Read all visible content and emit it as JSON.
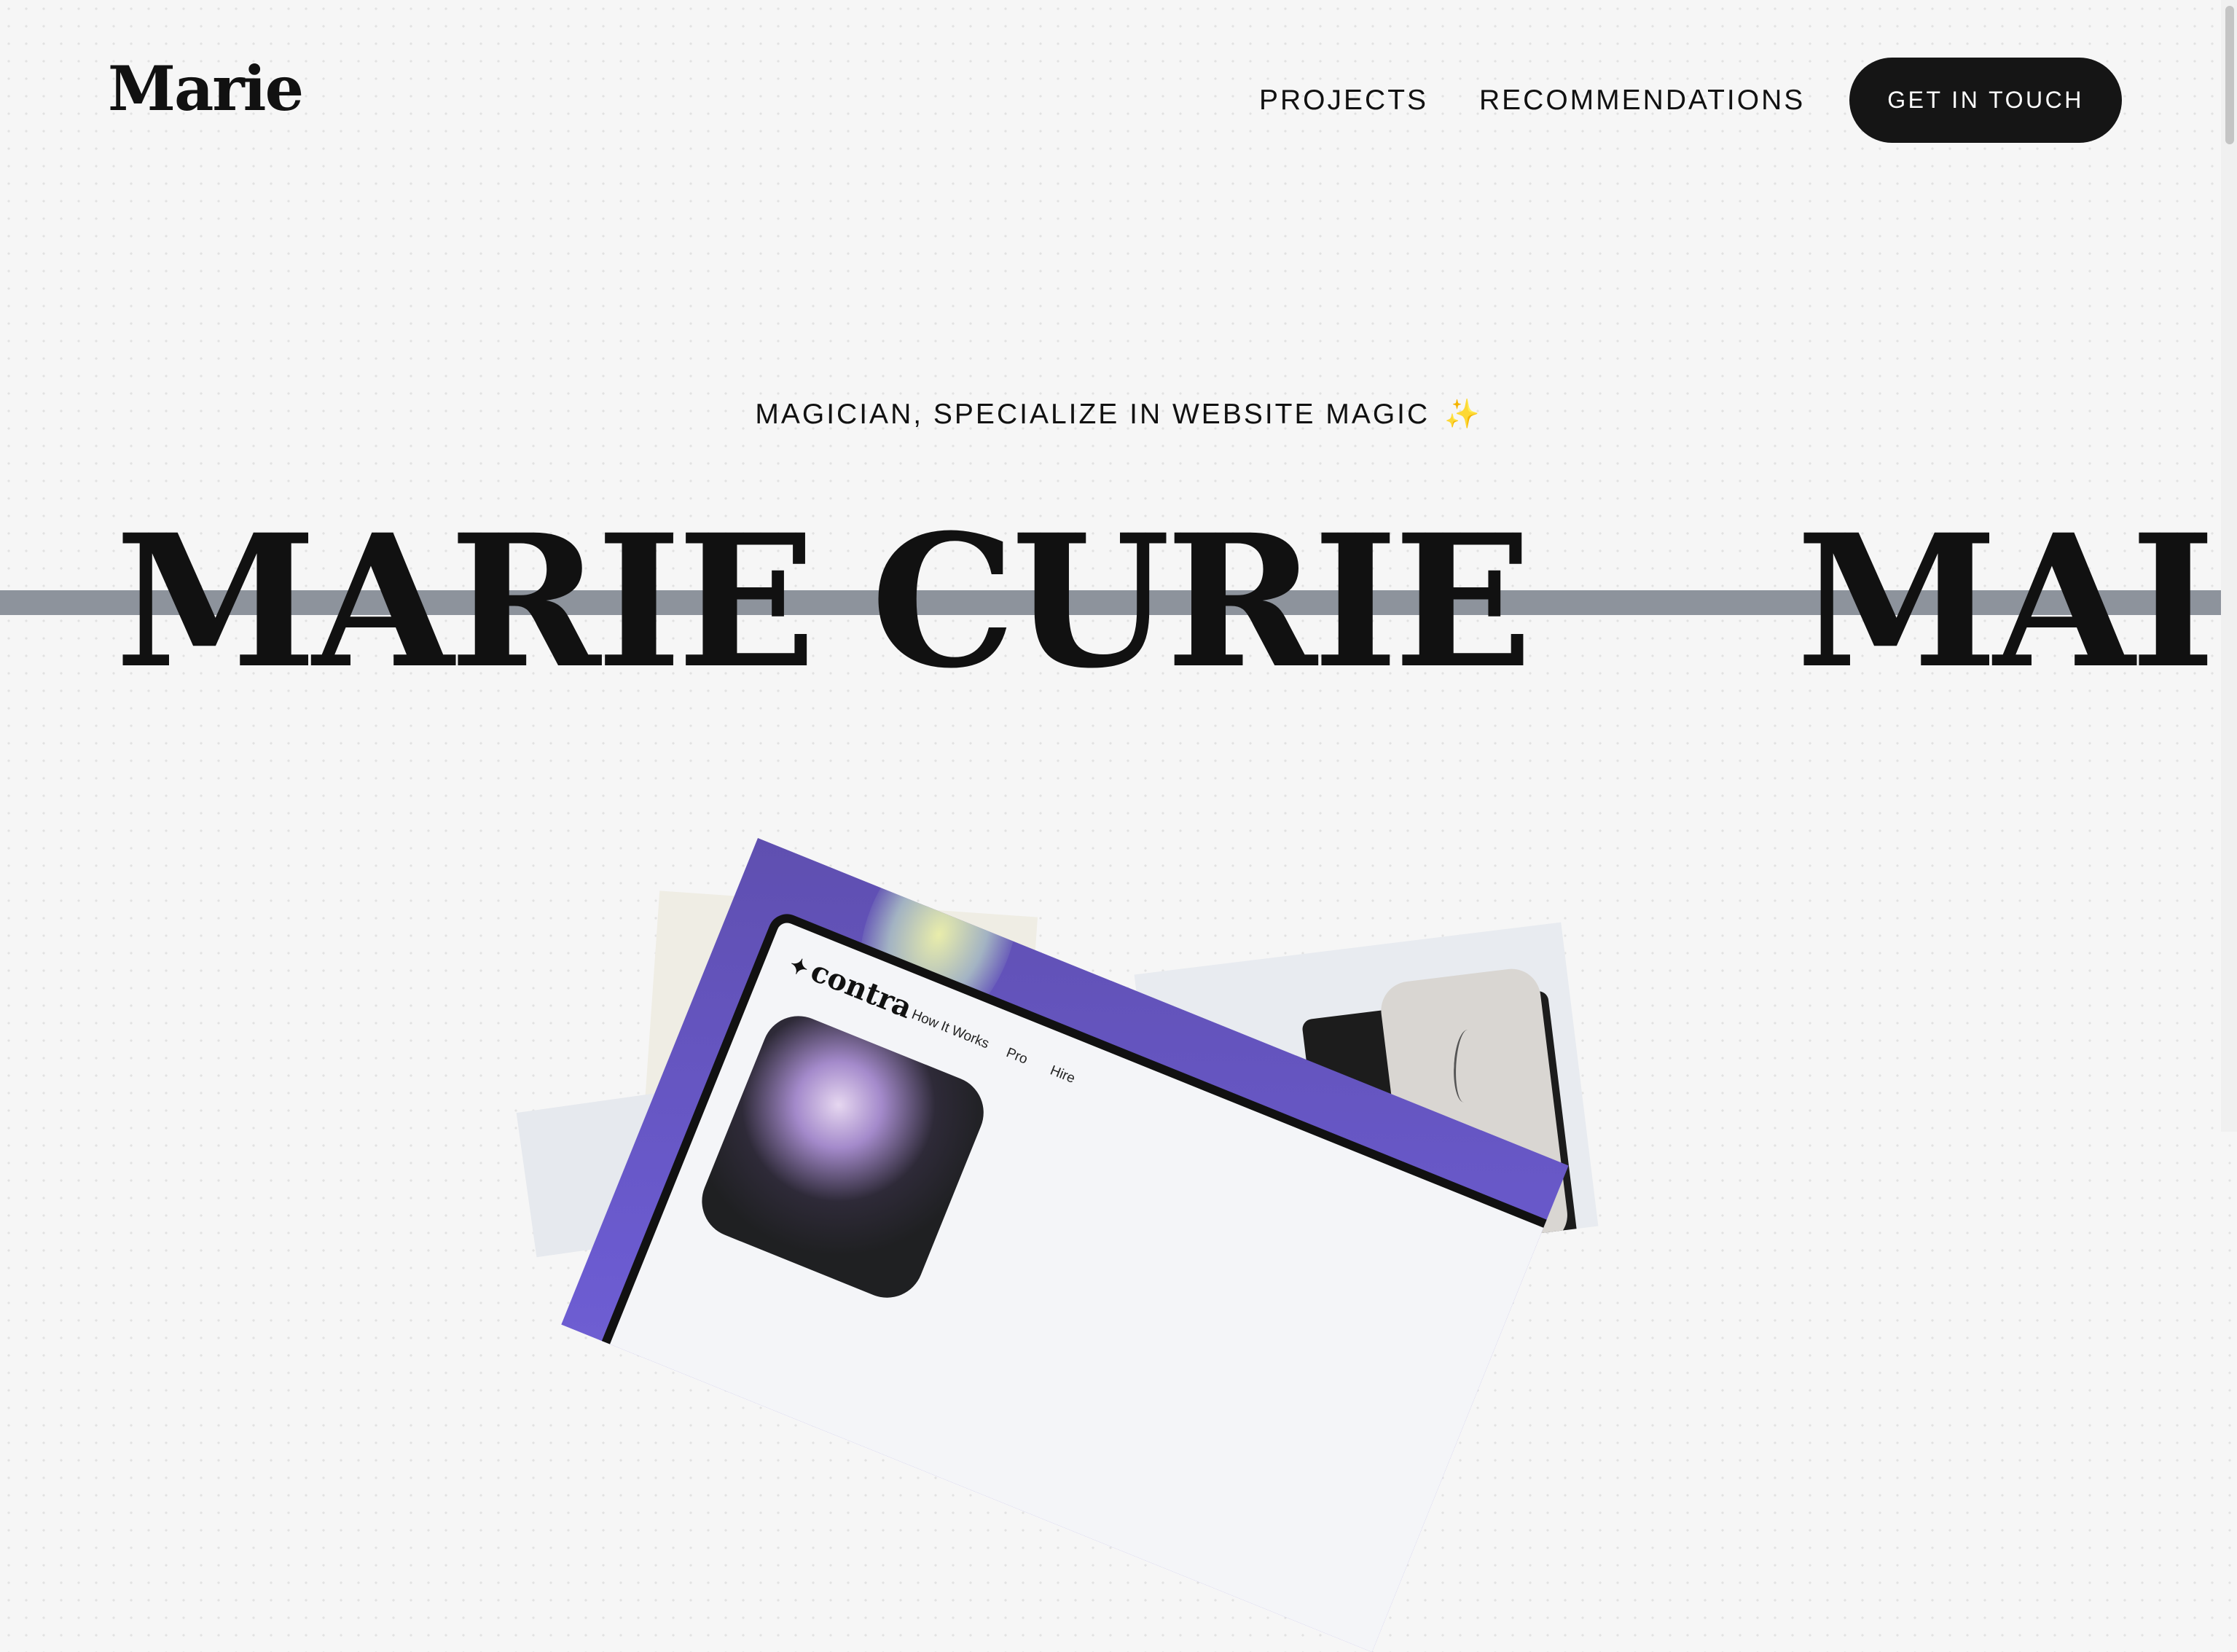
{
  "header": {
    "logo": "Marie",
    "nav": [
      {
        "label": "PROJECTS"
      },
      {
        "label": "RECOMMENDATIONS"
      }
    ],
    "cta_label": "GET IN TOUCH"
  },
  "hero": {
    "tagline": "MAGICIAN, SPECIALIZE IN WEBSITE MAGIC",
    "tagline_emoji": "✨",
    "marquee": [
      "MARIE CURIE",
      "MAI"
    ]
  },
  "projects": {
    "contra": {
      "logo": "contra",
      "nav": [
        "How It Works",
        "Pro",
        "Hire"
      ]
    }
  },
  "colors": {
    "background": "#f6f6f6",
    "text": "#111111",
    "cta_background": "#151515",
    "marquee_line": "#8d939c",
    "contra_purple": "#6b5bd0"
  }
}
